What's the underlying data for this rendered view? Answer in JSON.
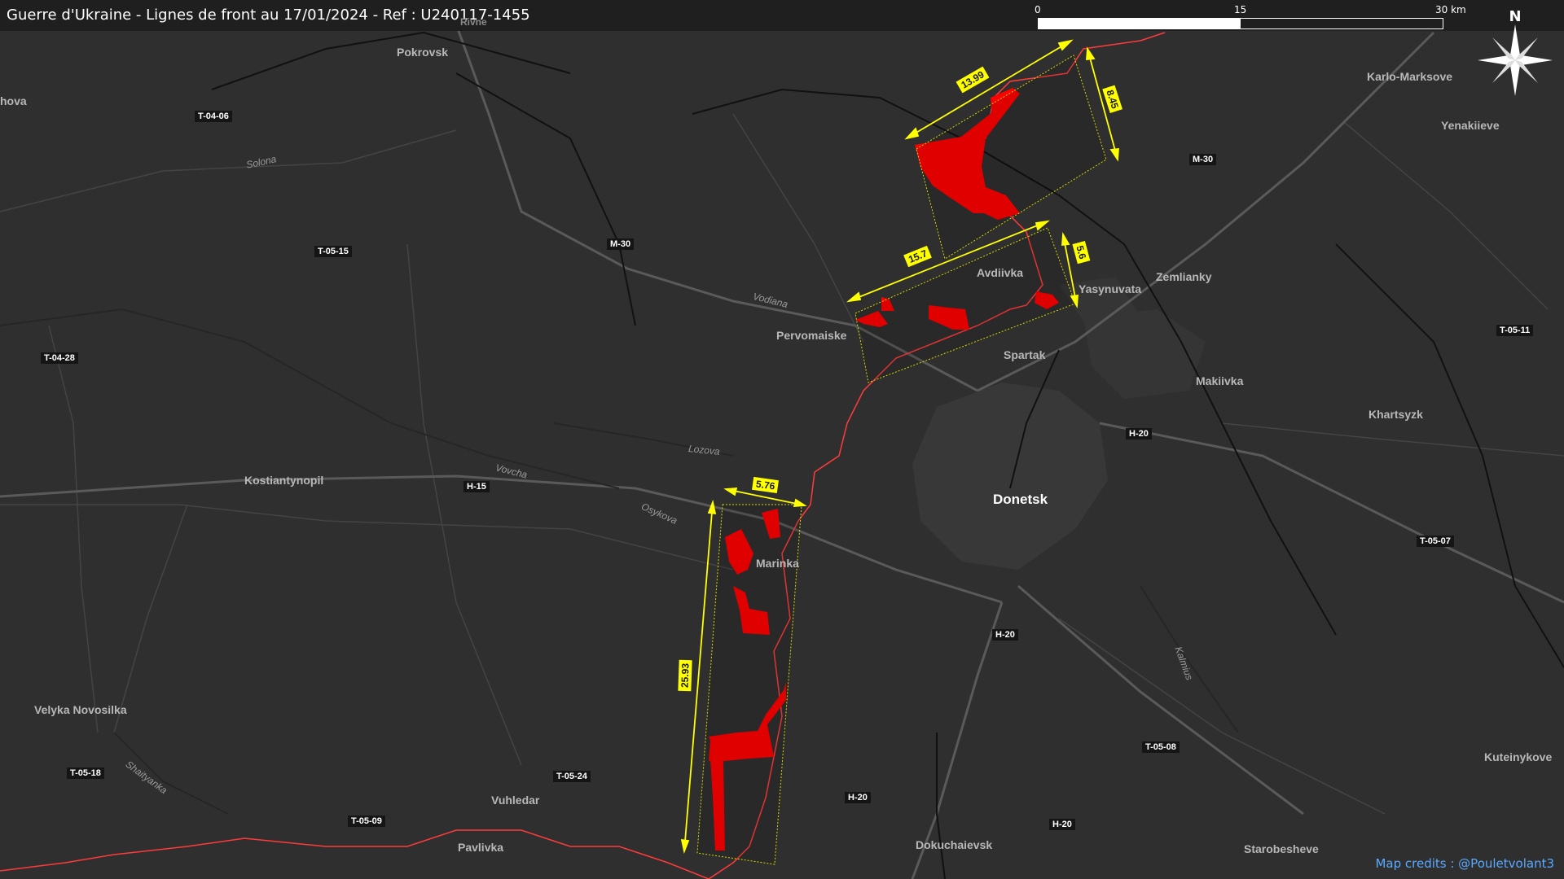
{
  "title": "Guerre d'Ukraine - Lignes de front au 17/01/2024 - Ref : U240117-1455",
  "scale": {
    "label_0": "0",
    "label_mid": "15",
    "label_end": "30 km"
  },
  "north_label": "N",
  "credits": "Map credits : @Pouletvolant3",
  "colors": {
    "front_line": "#ff3b3b",
    "occupied_gain": "#ff0000",
    "measure": "#ffff00",
    "background": "#2f2f2f"
  },
  "places": {
    "pokrovsk": "Pokrovsk",
    "hova": "hova",
    "rivne": "Rivne",
    "karlo_marksove": "Karlo-Marksove",
    "yenakiieve": "Yenakiieve",
    "avdiivka": "Avdiivka",
    "yasynuvata": "Yasynuvata",
    "zemlianky": "Zemlianky",
    "pervomaiske": "Pervomaiske",
    "spartak": "Spartak",
    "makiivka": "Makiivka",
    "khartsyzk": "Khartsyzk",
    "kostiantynopil": "Kostiantynopil",
    "donetsk": "Donetsk",
    "marinka": "Marinka",
    "velyka_novosilka": "Velyka Novosilka",
    "vuhledar": "Vuhledar",
    "pavlivka": "Pavlivka",
    "dokuchaievsk": "Dokuchaievsk",
    "starobesheve": "Starobesheve",
    "kuteinykove": "Kuteinykove"
  },
  "rivers": {
    "solona": "Solona",
    "vodiana": "Vodiana",
    "lozova": "Lozova",
    "vovcha": "Vovcha",
    "osykova": "Osykova",
    "shaitanka": "Shaityanka",
    "kalmius": "Kalmius"
  },
  "roads": {
    "t0406": "T-04-06",
    "m30a": "M-30",
    "m30b": "M-30",
    "t0515": "T-05-15",
    "t0428": "T-04-28",
    "t0511": "T-05-11",
    "h20a": "H-20",
    "h15": "H-15",
    "t0507": "T-05-07",
    "h20b": "H-20",
    "t0508": "T-05-08",
    "t0518": "T-05-18",
    "t0524": "T-05-24",
    "h20c": "H-20",
    "t0509": "T-05-09",
    "h20d": "H-20"
  },
  "measurements": {
    "north_width": "13.99",
    "north_height": "8.45",
    "mid_width": "15.7",
    "mid_height": "5.6",
    "south_width": "5.76",
    "south_height": "25.93"
  }
}
